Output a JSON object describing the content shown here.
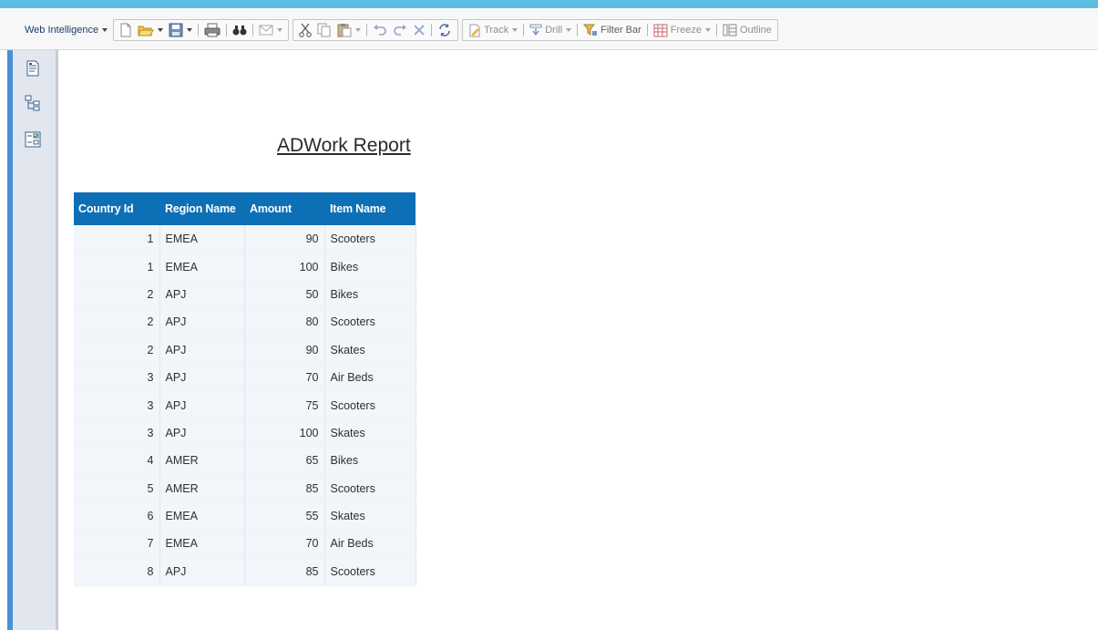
{
  "toolbar": {
    "app_menu_label": "Web Intelligence",
    "track_label": "Track",
    "drill_label": "Drill",
    "filter_bar_label": "Filter Bar",
    "freeze_label": "Freeze",
    "outline_label": "Outline"
  },
  "sidebar": {
    "items": [
      {
        "icon": "document-structure-icon"
      },
      {
        "icon": "navigation-map-icon"
      },
      {
        "icon": "input-controls-icon"
      }
    ]
  },
  "report": {
    "title": "ADWork Report",
    "columns": [
      "Country Id",
      "Region Name",
      "Amount",
      "Item Name"
    ],
    "rows": [
      [
        "1",
        "EMEA",
        "90",
        "Scooters"
      ],
      [
        "1",
        "EMEA",
        "100",
        "Bikes"
      ],
      [
        "2",
        "APJ",
        "50",
        "Bikes"
      ],
      [
        "2",
        "APJ",
        "80",
        "Scooters"
      ],
      [
        "2",
        "APJ",
        "90",
        "Skates"
      ],
      [
        "3",
        "APJ",
        "70",
        "Air Beds"
      ],
      [
        "3",
        "APJ",
        "75",
        "Scooters"
      ],
      [
        "3",
        "APJ",
        "100",
        "Skates"
      ],
      [
        "4",
        "AMER",
        "65",
        "Bikes"
      ],
      [
        "5",
        "AMER",
        "85",
        "Scooters"
      ],
      [
        "6",
        "EMEA",
        "55",
        "Skates"
      ],
      [
        "7",
        "EMEA",
        "70",
        "Air Beds"
      ],
      [
        "8",
        "APJ",
        "85",
        "Scooters"
      ]
    ]
  },
  "colors": {
    "header_bg": "#0d6fb5",
    "top_strip": "#5dbde3",
    "left_rail": "#4a8ed7"
  }
}
